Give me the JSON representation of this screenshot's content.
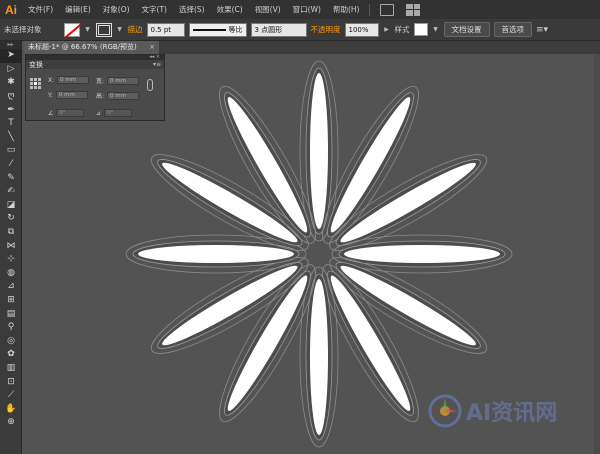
{
  "app": {
    "logo_text": "Ai"
  },
  "menu": {
    "items": [
      "文件(F)",
      "编辑(E)",
      "对象(O)",
      "文字(T)",
      "选择(S)",
      "效果(C)",
      "视图(V)",
      "窗口(W)",
      "帮助(H)"
    ]
  },
  "control_bar": {
    "selection_label": "未选择对象",
    "stroke_label": "描边",
    "stroke_weight": "0.5 pt",
    "stroke_profile": "等比",
    "brush": "3 点圆形",
    "opacity_label": "不透明度",
    "opacity_value": "100%",
    "style_label": "样式",
    "doc_setup_button": "文档设置",
    "prefs_button": "首选项"
  },
  "document_tab": {
    "title": "未标题-1* @ 66.67% (RGB/预览)",
    "close": "×"
  },
  "transform_panel": {
    "title": "变换",
    "x_label": "X:",
    "x_value": "0 mm",
    "y_label": "Y:",
    "y_value": "0 mm",
    "w_label": "宽:",
    "w_value": "0 mm",
    "h_label": "高:",
    "h_value": "0 mm",
    "rotate_value": "0°",
    "shear_value": "0°"
  },
  "watermark": {
    "text": "AI资讯网"
  },
  "colors": {
    "ui_dark": "#323232",
    "canvas": "#535353",
    "petal_fill": "#ffffff",
    "accent": "#ff9a00"
  },
  "icons": [
    "arrow-select-icon",
    "direct-select-icon",
    "magic-wand-icon",
    "lasso-icon",
    "pen-icon",
    "type-icon",
    "line-icon",
    "rectangle-icon",
    "brush-icon",
    "pencil-icon",
    "eraser-icon",
    "rotate-icon",
    "scale-icon",
    "width-icon",
    "free-transform-icon",
    "shape-builder-icon",
    "perspective-icon",
    "mesh-icon",
    "gradient-icon",
    "eyedropper-icon",
    "blend-icon",
    "symbol-sprayer-icon",
    "graph-icon",
    "artboard-icon",
    "slice-icon",
    "hand-icon"
  ]
}
